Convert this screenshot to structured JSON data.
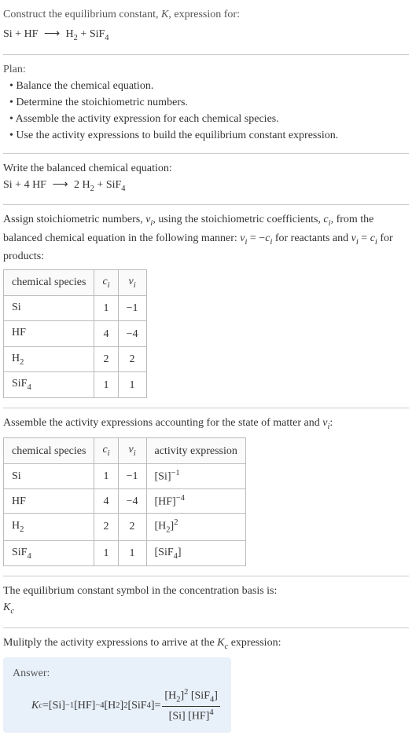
{
  "header": {
    "title_pre": "Construct the equilibrium constant, ",
    "title_var": "K",
    "title_post": ", expression for:",
    "eq_lhs": "Si + HF",
    "eq_arrow": "⟶",
    "eq_rhs_h2": "H",
    "eq_rhs_h2_sub": "2",
    "eq_rhs_plus": " + SiF",
    "eq_rhs_sif4_sub": "4"
  },
  "plan": {
    "label": "Plan:",
    "items": [
      "• Balance the chemical equation.",
      "• Determine the stoichiometric numbers.",
      "• Assemble the activity expression for each chemical species.",
      "• Use the activity expressions to build the equilibrium constant expression."
    ]
  },
  "balanced": {
    "label": "Write the balanced chemical equation:",
    "eq_lhs": "Si + 4 HF",
    "eq_arrow": "⟶",
    "eq_rhs_pre": "2 H",
    "eq_rhs_h2_sub": "2",
    "eq_rhs_plus": " + SiF",
    "eq_rhs_sif4_sub": "4"
  },
  "stoich": {
    "label_1": "Assign stoichiometric numbers, ",
    "nu": "ν",
    "i": "i",
    "label_2": ", using the stoichiometric coefficients, ",
    "c": "c",
    "label_3": ", from the balanced chemical equation in the following manner: ",
    "rel1_a": "ν",
    "rel1_b": "i",
    "rel1_c": " = −",
    "rel1_d": "c",
    "rel1_e": "i",
    "label_4": " for reactants and ",
    "rel2_a": "ν",
    "rel2_b": "i",
    "rel2_c": " = ",
    "rel2_d": "c",
    "rel2_e": "i",
    "label_5": " for products:",
    "headers": {
      "species": "chemical species",
      "c_var": "c",
      "c_sub": "i",
      "nu_var": "ν",
      "nu_sub": "i"
    },
    "rows": [
      {
        "name_a": "Si",
        "name_b": "",
        "c": "1",
        "nu": "−1"
      },
      {
        "name_a": "HF",
        "name_b": "",
        "c": "4",
        "nu": "−4"
      },
      {
        "name_a": "H",
        "name_b": "2",
        "c": "2",
        "nu": "2"
      },
      {
        "name_a": "SiF",
        "name_b": "4",
        "c": "1",
        "nu": "1"
      }
    ]
  },
  "activity": {
    "label_1": "Assemble the activity expressions accounting for the state of matter and ",
    "nu": "ν",
    "i": "i",
    "label_2": ":",
    "headers": {
      "species": "chemical species",
      "c_var": "c",
      "c_sub": "i",
      "nu_var": "ν",
      "nu_sub": "i",
      "expr": "activity expression"
    },
    "rows": [
      {
        "name_a": "Si",
        "name_b": "",
        "c": "1",
        "nu": "−1",
        "expr_base": "[Si]",
        "expr_sup": "−1"
      },
      {
        "name_a": "HF",
        "name_b": "",
        "c": "4",
        "nu": "−4",
        "expr_base": "[HF]",
        "expr_sup": "−4"
      },
      {
        "name_a": "H",
        "name_b": "2",
        "c": "2",
        "nu": "2",
        "expr_base_pre": "[H",
        "expr_base_sub": "2",
        "expr_base_post": "]",
        "expr_sup": "2"
      },
      {
        "name_a": "SiF",
        "name_b": "4",
        "c": "1",
        "nu": "1",
        "expr_base_pre": "[SiF",
        "expr_base_sub": "4",
        "expr_base_post": "]",
        "expr_sup": ""
      }
    ]
  },
  "symbol": {
    "label": "The equilibrium constant symbol in the concentration basis is:",
    "kc_var": "K",
    "kc_sub": "c"
  },
  "multiply": {
    "label_1": "Mulitply the activity expressions to arrive at the ",
    "kc_var": "K",
    "kc_sub": "c",
    "label_2": " expression:"
  },
  "answer": {
    "label": "Answer:",
    "kc_var": "K",
    "kc_sub": "c",
    "eq": " = ",
    "t1": "[Si]",
    "t1_sup": "−1",
    "t2": " [HF]",
    "t2_sup": "−4",
    "t3_pre": " [H",
    "t3_sub": "2",
    "t3_post": "]",
    "t3_sup": "2",
    "t4_pre": " [SiF",
    "t4_sub": "4",
    "t4_post": "]",
    "eq2": " = ",
    "num_a_pre": "[H",
    "num_a_sub": "2",
    "num_a_post": "]",
    "num_a_sup": "2",
    "num_b_pre": " [SiF",
    "num_b_sub": "4",
    "num_b_post": "]",
    "den_a": "[Si] [HF]",
    "den_sup": "4"
  }
}
